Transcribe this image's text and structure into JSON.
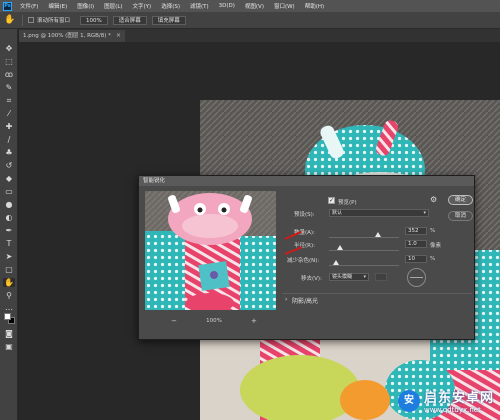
{
  "app": {
    "logo": "Ps"
  },
  "menu": [
    "文件(F)",
    "编辑(E)",
    "图像(I)",
    "图层(L)",
    "文字(Y)",
    "选择(S)",
    "滤镜(T)",
    "3D(D)",
    "视图(V)",
    "窗口(W)",
    "帮助(H)"
  ],
  "options_bar": {
    "scroll_all_windows_label": "滚动所有窗口",
    "zoom_value": "100%",
    "fit_screen_label": "适合屏幕",
    "fill_screen_label": "填充屏幕"
  },
  "document": {
    "tab_title": "1.png @ 100% (图层 1, RGB/8) *",
    "close_glyph": "×"
  },
  "dialog": {
    "title": "智能锐化",
    "preview_label": "预览(P)",
    "preset_label": "预设(S):",
    "preset_value": "默认",
    "amount_label": "数量(A):",
    "amount_value": "352",
    "amount_unit": "%",
    "amount_fraction": 0.7,
    "radius_label": "半径(R):",
    "radius_value": "1.0",
    "radius_unit": "像素",
    "radius_fraction": 0.16,
    "noise_label": "减少杂色(N):",
    "noise_value": "10",
    "noise_unit": "%",
    "noise_fraction": 0.1,
    "remove_label": "移去(V):",
    "remove_value": "镜头模糊",
    "shadows_highlights_label": "阴影/高光",
    "ok_label": "确定",
    "cancel_label": "取消",
    "zoom_level": "100%",
    "zoom_out_glyph": "−",
    "zoom_in_glyph": "+"
  },
  "watermark": {
    "logo": "安",
    "line1": "启东安卓网",
    "line2": "www.qdtdyx.net"
  },
  "colors": {
    "foreground": "#ffffff",
    "background": "#000000",
    "annotation_arrow": "#d21a1a"
  }
}
